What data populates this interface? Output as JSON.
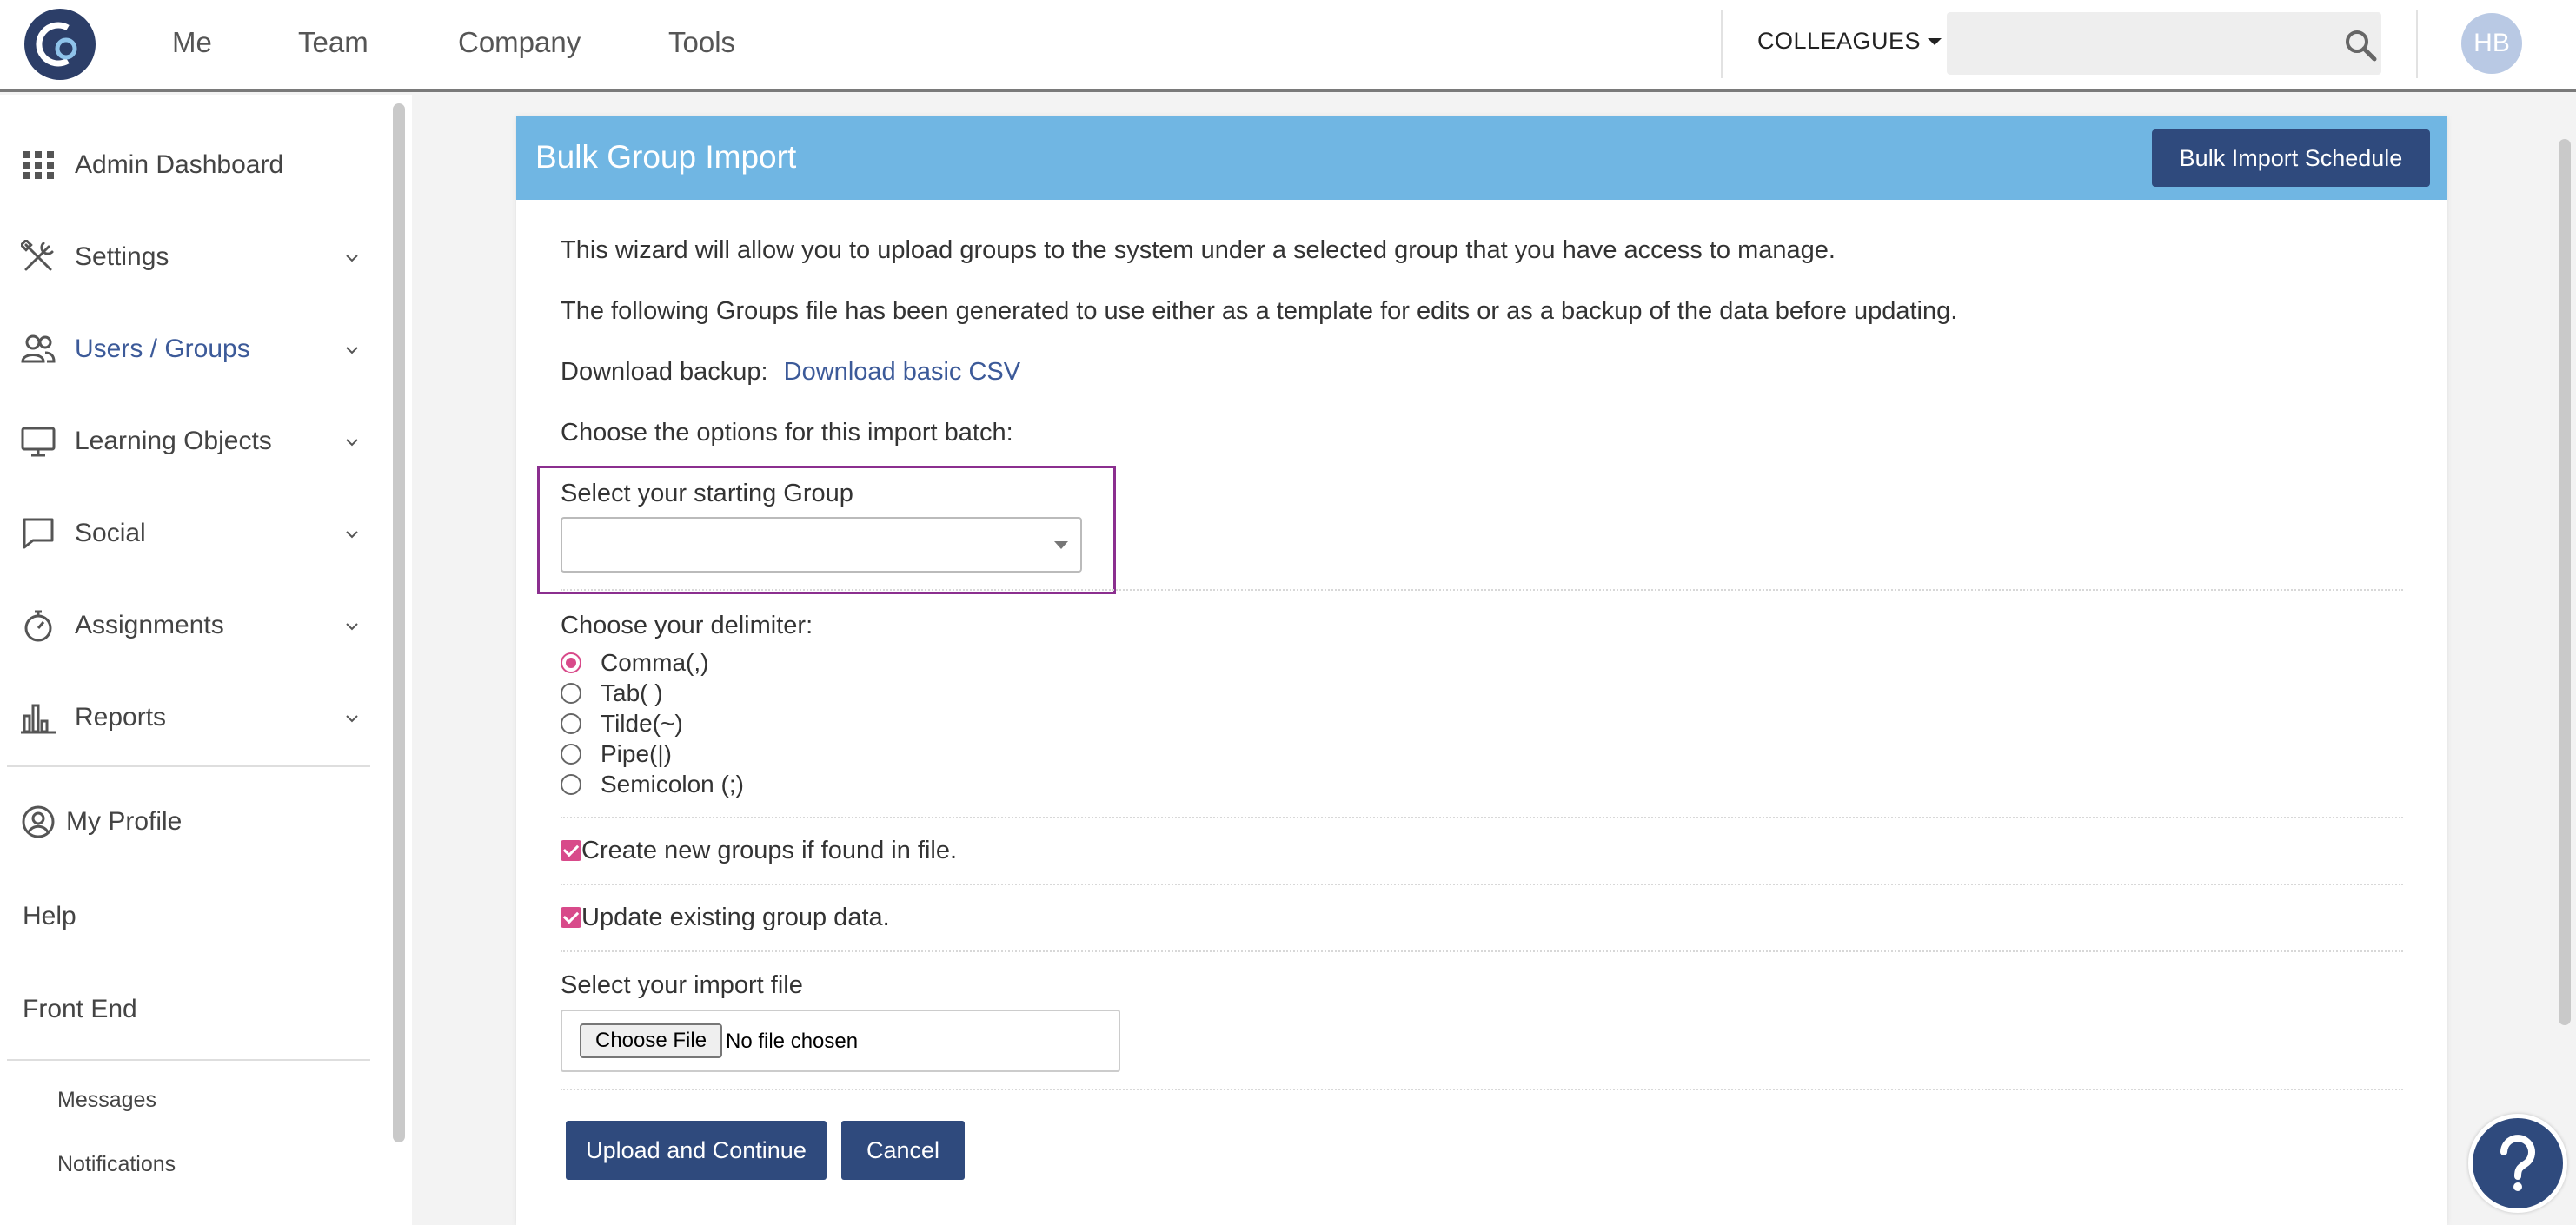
{
  "nav": {
    "items": [
      "Me",
      "Team",
      "Company",
      "Tools"
    ],
    "colleagues_label": "COLLEAGUES",
    "search_placeholder": "",
    "avatar_initials": "HB"
  },
  "sidebar": {
    "items": [
      {
        "label": "Admin Dashboard",
        "icon": "grid-icon",
        "has_chevron": false
      },
      {
        "label": "Settings",
        "icon": "tools-icon",
        "has_chevron": true
      },
      {
        "label": "Users / Groups",
        "icon": "users-icon",
        "has_chevron": true,
        "active": true
      },
      {
        "label": "Learning Objects",
        "icon": "monitor-icon",
        "has_chevron": true
      },
      {
        "label": "Social",
        "icon": "chat-icon",
        "has_chevron": true
      },
      {
        "label": "Assignments",
        "icon": "stopwatch-icon",
        "has_chevron": true
      },
      {
        "label": "Reports",
        "icon": "bar-chart-icon",
        "has_chevron": true
      }
    ],
    "profile": "My Profile",
    "help": "Help",
    "front_end": "Front End",
    "messages": "Messages",
    "notifications": "Notifications"
  },
  "panel": {
    "title": "Bulk Group Import",
    "schedule_button": "Bulk Import Schedule",
    "intro": "This wizard will allow you to upload groups to the system under a selected group that you have access to manage.",
    "template_note": "The following Groups file has been generated to use either as a template for edits or as a backup of the data before updating.",
    "download_label": "Download backup:",
    "download_link": "Download basic CSV",
    "options_label": "Choose the options for this import batch:",
    "starting_group_label": "Select your starting Group",
    "starting_group_value": "",
    "delimiter_label": "Choose your delimiter:",
    "delimiters": [
      "Comma(,)",
      "Tab( )",
      "Tilde(~)",
      "Pipe(|)",
      "Semicolon (;)"
    ],
    "selected_delimiter": "Comma(,)",
    "create_groups_label": "Create new groups if found in file.",
    "create_groups_checked": true,
    "update_groups_label": "Update existing group data.",
    "update_groups_checked": true,
    "file_label": "Select your import file",
    "file_button": "Choose File",
    "file_status": "No file chosen",
    "upload_button": "Upload and Continue",
    "cancel_button": "Cancel"
  },
  "colors": {
    "header_blue": "#70b6e3",
    "navy": "#2f4a7d",
    "accent_pink": "#d84a8a",
    "highlight_purple": "#8b2f8f",
    "link_blue": "#3c5a99"
  }
}
